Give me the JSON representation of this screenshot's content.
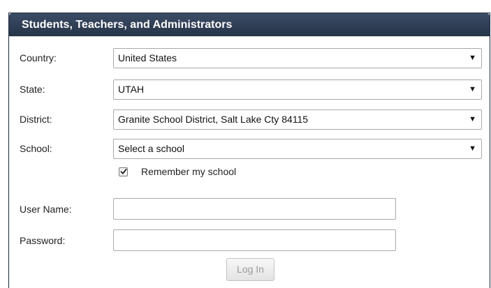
{
  "header": {
    "title": "Students, Teachers, and Administrators"
  },
  "form": {
    "country": {
      "label": "Country:",
      "value": "United States"
    },
    "state": {
      "label": "State:",
      "value": "UTAH"
    },
    "district": {
      "label": "District:",
      "value": "Granite School District, Salt Lake Cty 84115"
    },
    "school": {
      "label": "School:",
      "value": "Select a school"
    },
    "remember": {
      "label": "Remember my school",
      "checked": true
    },
    "username": {
      "label": "User Name:",
      "value": ""
    },
    "password": {
      "label": "Password:",
      "value": ""
    },
    "login_label": "Log In"
  },
  "icons": {
    "dropdown": "dropdown-arrow-icon",
    "check": "checkmark-icon"
  }
}
